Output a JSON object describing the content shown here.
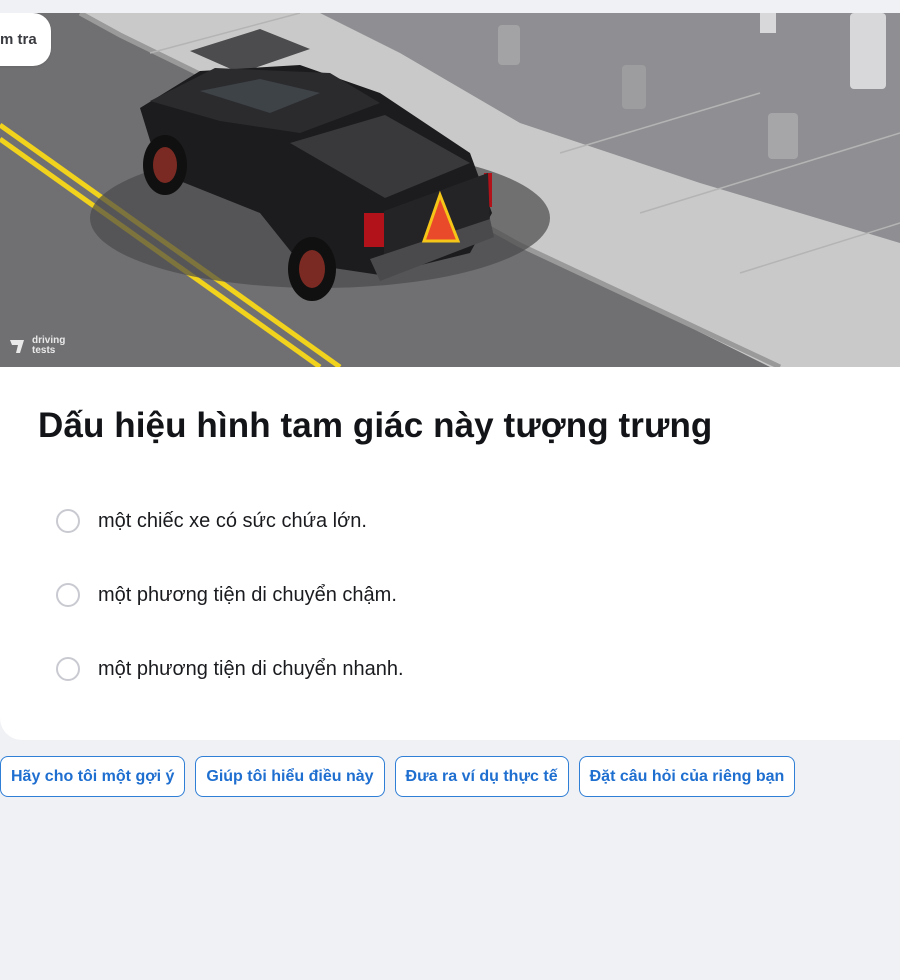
{
  "badge": {
    "text": "m tra"
  },
  "image": {
    "description_icon": "truck-photo",
    "watermark_text": "driving tests"
  },
  "question": {
    "text": "Dấu hiệu hình tam giác này tượng trưng"
  },
  "options": [
    {
      "label": "một chiếc xe có sức chứa lớn."
    },
    {
      "label": "một phương tiện di chuyển chậm."
    },
    {
      "label": "một phương tiện di chuyển nhanh."
    }
  ],
  "chips": [
    {
      "label": "Hãy cho tôi một gợi ý"
    },
    {
      "label": "Giúp tôi hiểu điều này"
    },
    {
      "label": "Đưa ra ví dụ thực tế"
    },
    {
      "label": "Đặt câu hỏi của riêng bạn"
    }
  ],
  "colors": {
    "accent": "#1f6fd0",
    "background": "#f0f1f5",
    "sign_orange": "#e94a2a",
    "sign_yellow": "#f5c518"
  }
}
